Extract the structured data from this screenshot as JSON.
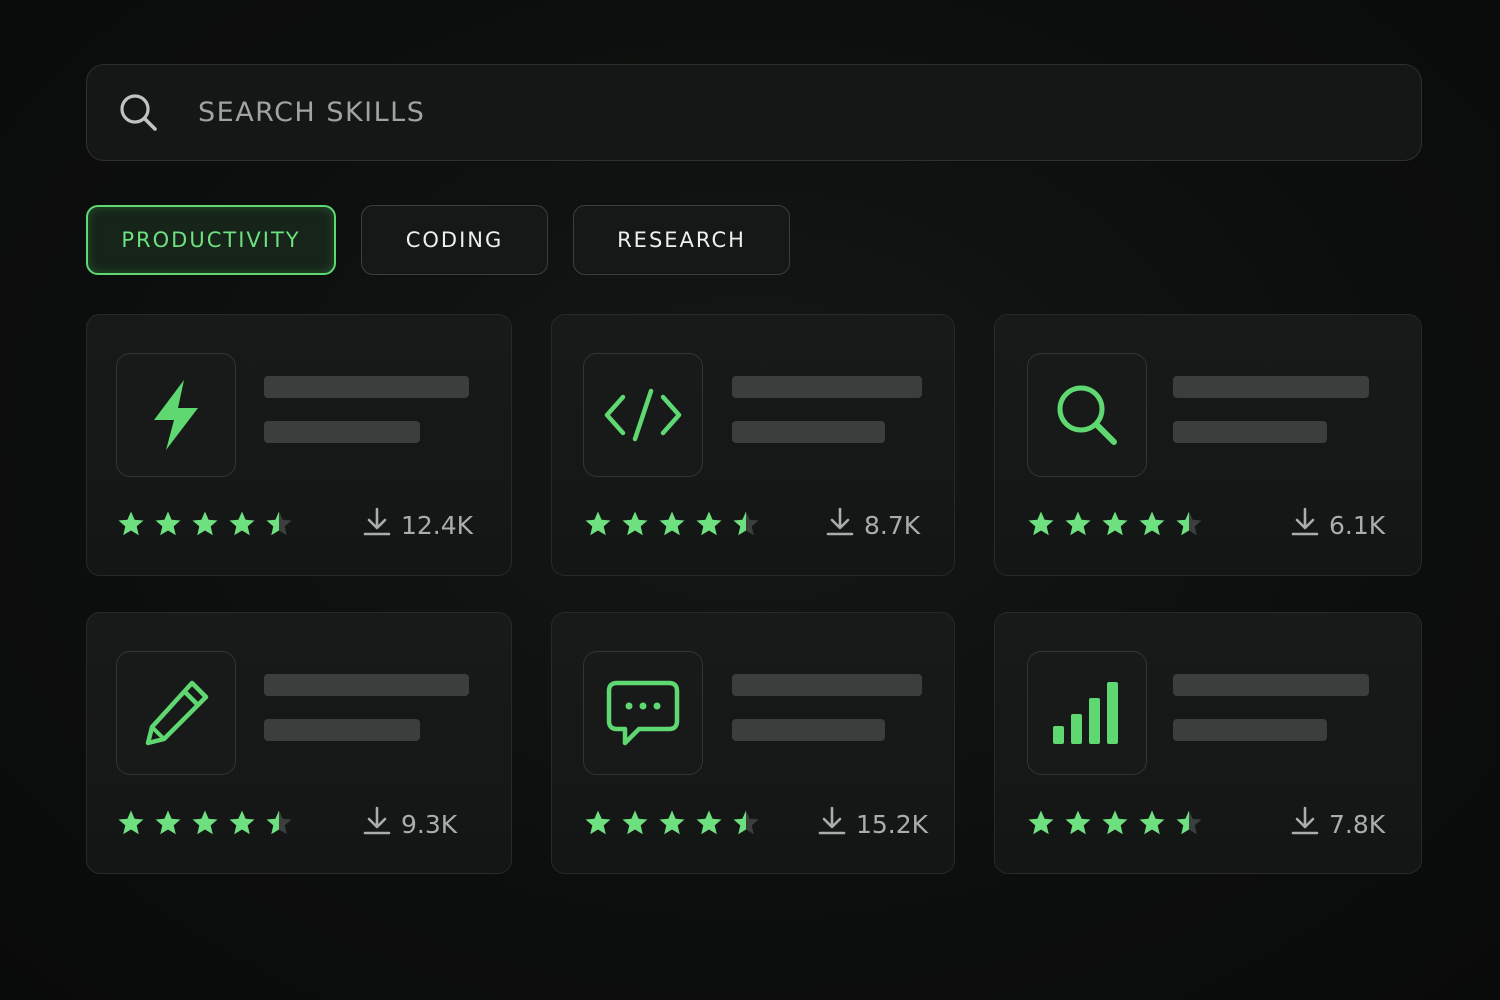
{
  "search": {
    "placeholder": "SEARCH SKILLS",
    "icon": "search-icon"
  },
  "tabs": [
    {
      "label": "PRODUCTIVITY",
      "active": true
    },
    {
      "label": "CODING",
      "active": false
    },
    {
      "label": "RESEARCH",
      "active": false
    }
  ],
  "cards": [
    {
      "icon": "lightning-icon",
      "rating": 4.5,
      "downloads": "12.4K"
    },
    {
      "icon": "code-icon",
      "rating": 4.5,
      "downloads": "8.7K"
    },
    {
      "icon": "magnifier-icon",
      "rating": 4.5,
      "downloads": "6.1K"
    },
    {
      "icon": "pencil-icon",
      "rating": 4.5,
      "downloads": "9.3K"
    },
    {
      "icon": "chat-bubble-icon",
      "rating": 4.5,
      "downloads": "15.2K"
    },
    {
      "icon": "bar-chart-icon",
      "rating": 4.5,
      "downloads": "7.8K"
    }
  ],
  "colors": {
    "accent": "#6ee07f",
    "background": "#0d0f0e",
    "card": "#151816",
    "placeholder_bar": "#3a3e3c"
  }
}
